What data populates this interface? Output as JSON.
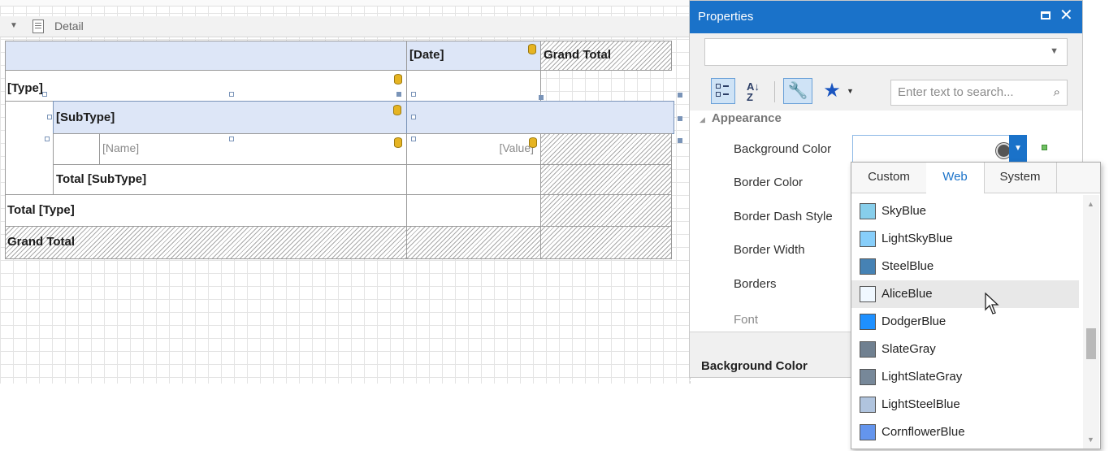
{
  "designer": {
    "band_label": "Detail",
    "cells": {
      "date": "[Date]",
      "grand_total_col": "Grand Total",
      "type": "[Type]",
      "subtype": "[SubType]",
      "name": "[Name]",
      "value": "[Value]",
      "total_subtype": "Total [SubType]",
      "total_type": "Total [Type]",
      "grand_total_row": "Grand Total"
    }
  },
  "properties": {
    "title": "Properties",
    "search_placeholder": "Enter text to search...",
    "category": "Appearance",
    "items": [
      {
        "label": "Background Color"
      },
      {
        "label": "Border Color"
      },
      {
        "label": "Border Dash Style"
      },
      {
        "label": "Border Width"
      },
      {
        "label": "Borders"
      },
      {
        "label": "Font"
      }
    ],
    "description_title": "Background Color",
    "toolbar": {
      "categorized_icon": "categorized-icon",
      "alphabetical_icon": "sort-az-icon",
      "properties_icon": "wrench-icon",
      "favorites_icon": "star-icon"
    }
  },
  "color_dropdown": {
    "tabs": [
      {
        "label": "Custom",
        "active": false
      },
      {
        "label": "Web",
        "active": true
      },
      {
        "label": "System",
        "active": false
      }
    ],
    "hovered": "AliceBlue",
    "colors": [
      {
        "name": "SkyBlue",
        "hex": "#87CEEB"
      },
      {
        "name": "LightSkyBlue",
        "hex": "#87CEFA"
      },
      {
        "name": "SteelBlue",
        "hex": "#4682B4"
      },
      {
        "name": "AliceBlue",
        "hex": "#F0F8FF"
      },
      {
        "name": "DodgerBlue",
        "hex": "#1E90FF"
      },
      {
        "name": "SlateGray",
        "hex": "#708090"
      },
      {
        "name": "LightSlateGray",
        "hex": "#778899"
      },
      {
        "name": "LightSteelBlue",
        "hex": "#B0C4DE"
      },
      {
        "name": "CornflowerBlue",
        "hex": "#6495ED"
      }
    ]
  },
  "theme": {
    "accent": "#1A72C9",
    "header_cell": "#DDE6F7"
  }
}
